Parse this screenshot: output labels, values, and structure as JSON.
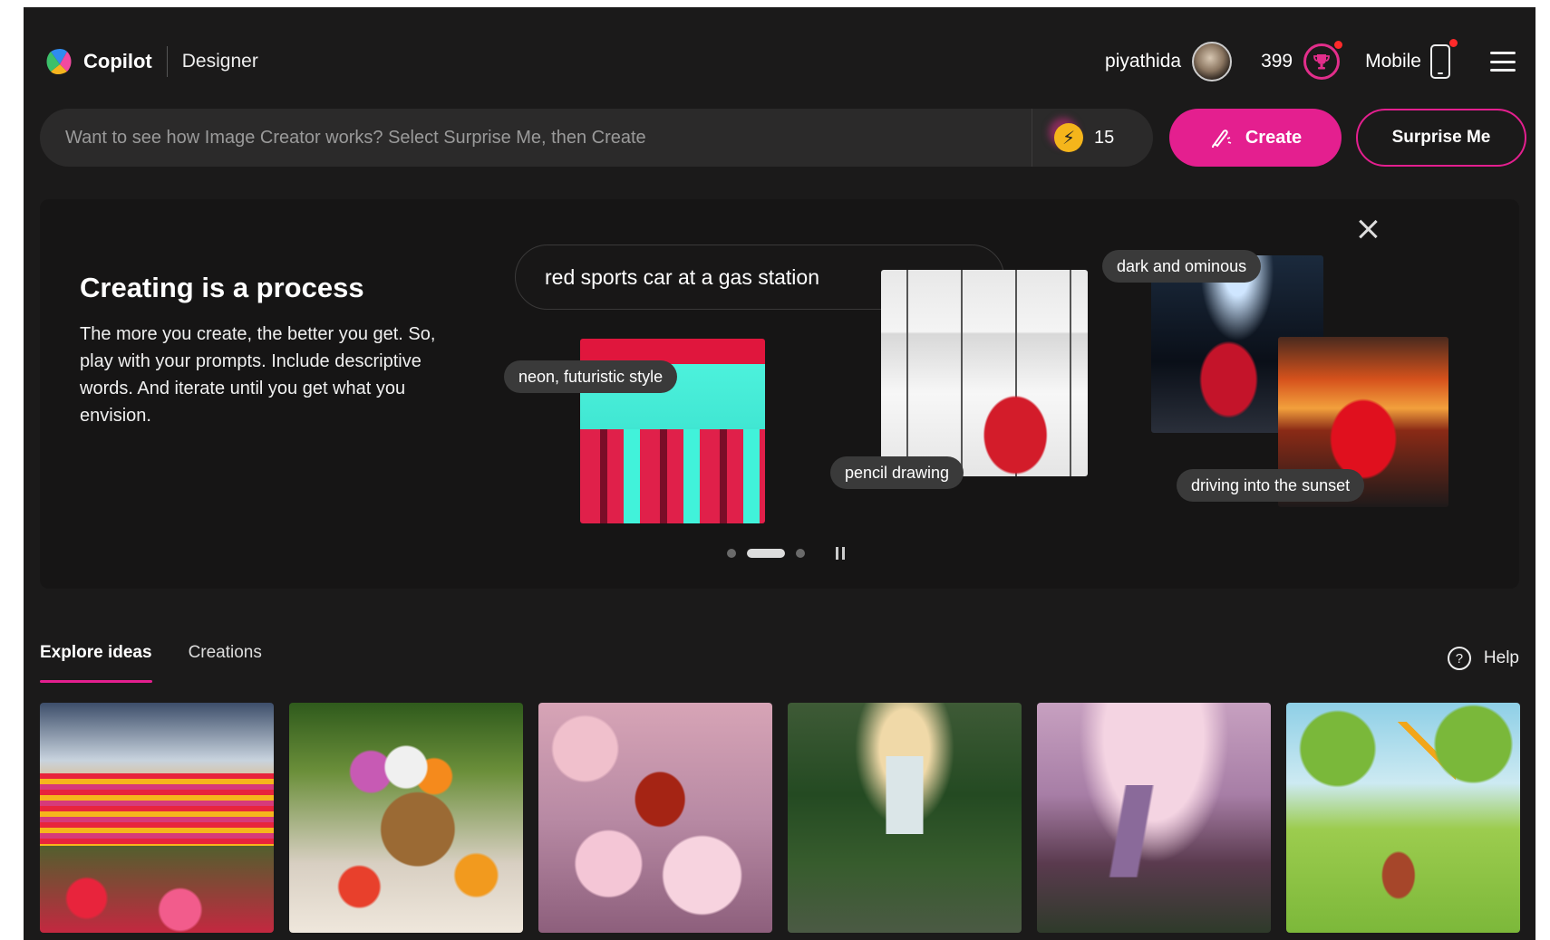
{
  "header": {
    "brand_name": "Copilot",
    "brand_sub": "Designer",
    "user_name": "piyathida",
    "points": "399",
    "mobile_label": "Mobile"
  },
  "prompt": {
    "placeholder": "Want to see how Image Creator works? Select Surprise Me, then Create",
    "boosts": "15",
    "create_label": "Create",
    "surprise_label": "Surprise Me"
  },
  "banner": {
    "title": "Creating is a process",
    "text": "The more you create, the better you get. So, play with your prompts. Include descriptive words. And iterate until you get what you envision.",
    "example_prompt": "red sports car at a gas station",
    "tags": {
      "neon": "neon, futuristic style",
      "pencil": "pencil drawing",
      "dark": "dark and ominous",
      "sunset": "driving into the sunset"
    },
    "carousel": {
      "count": 3,
      "active_index": 1
    }
  },
  "tabs": [
    {
      "label": "Explore ideas",
      "active": true
    },
    {
      "label": "Creations",
      "active": false
    }
  ],
  "help_label": "Help",
  "colors": {
    "accent": "#e41f8f",
    "background": "#1b1a1a",
    "prompt_bar": "#2b2a2a",
    "boost": "#f5b51b"
  }
}
